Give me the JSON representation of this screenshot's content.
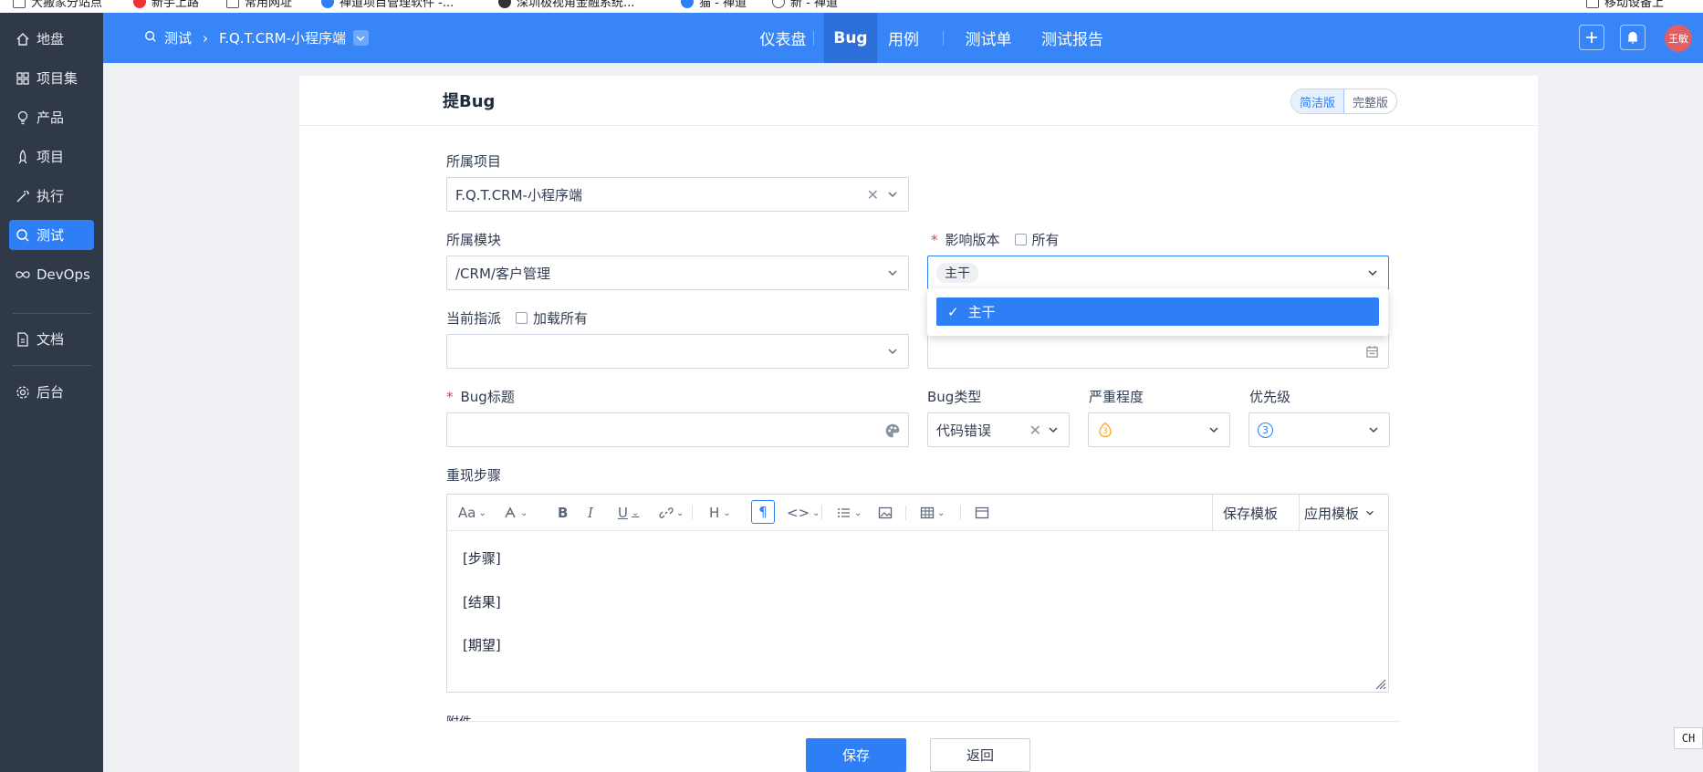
{
  "bookmarks": [
    "大搬家分站点",
    "新手上路",
    "常用网址",
    "禅道项目管理软件 -...",
    "深圳极视角金融系统...",
    "猫 - 禅道",
    "新 - 禅道",
    "移动设备上"
  ],
  "sidebar": {
    "items": [
      {
        "label": "地盘",
        "icon": "home-icon"
      },
      {
        "label": "项目集",
        "icon": "grid-icon"
      },
      {
        "label": "产品",
        "icon": "bulb-icon"
      },
      {
        "label": "项目",
        "icon": "rocket-icon"
      },
      {
        "label": "执行",
        "icon": "wand-icon"
      },
      {
        "label": "测试",
        "icon": "search-icon"
      },
      {
        "label": "DevOps",
        "icon": "infinity-icon"
      },
      {
        "label": "文档",
        "icon": "document-icon"
      },
      {
        "label": "后台",
        "icon": "gear-icon"
      }
    ],
    "active": "测试"
  },
  "header": {
    "breadcrumb_root": "测试",
    "breadcrumb_product": "F.Q.T.CRM-小程序端",
    "tabs": [
      "仪表盘",
      "Bug",
      "用例",
      "测试单",
      "测试报告"
    ],
    "active_tab": "Bug",
    "user": "王敏"
  },
  "form": {
    "title": "提Bug",
    "mode_simple": "简洁版",
    "mode_full": "完整版",
    "project_label": "所属项目",
    "project_value": "F.Q.T.CRM-小程序端",
    "module_label": "所属模块",
    "module_value": "/CRM/客户管理",
    "version_label": "影响版本",
    "version_all_label": "所有",
    "version_value": "主干",
    "version_option": "主干",
    "assign_label": "当前指派",
    "assign_load_all": "加载所有",
    "assign_value": "",
    "deadline_value": "",
    "title_label": "Bug标题",
    "title_value": "",
    "type_label": "Bug类型",
    "type_value": "代码错误",
    "severity_label": "严重程度",
    "severity_value": "3",
    "priority_label": "优先级",
    "priority_value": "3",
    "steps_label": "重现步骤",
    "save_template": "保存模板",
    "apply_template": "应用模板",
    "steps_lines": [
      "[步骤]",
      "[结果]",
      "[期望]"
    ],
    "attachment_label": "附件",
    "save_button": "保存",
    "back_button": "返回"
  },
  "ime_indicator": "CH",
  "colors": {
    "accent": "#2e7ff5",
    "header": "#3785f7",
    "sidebar": "#2f3948"
  }
}
